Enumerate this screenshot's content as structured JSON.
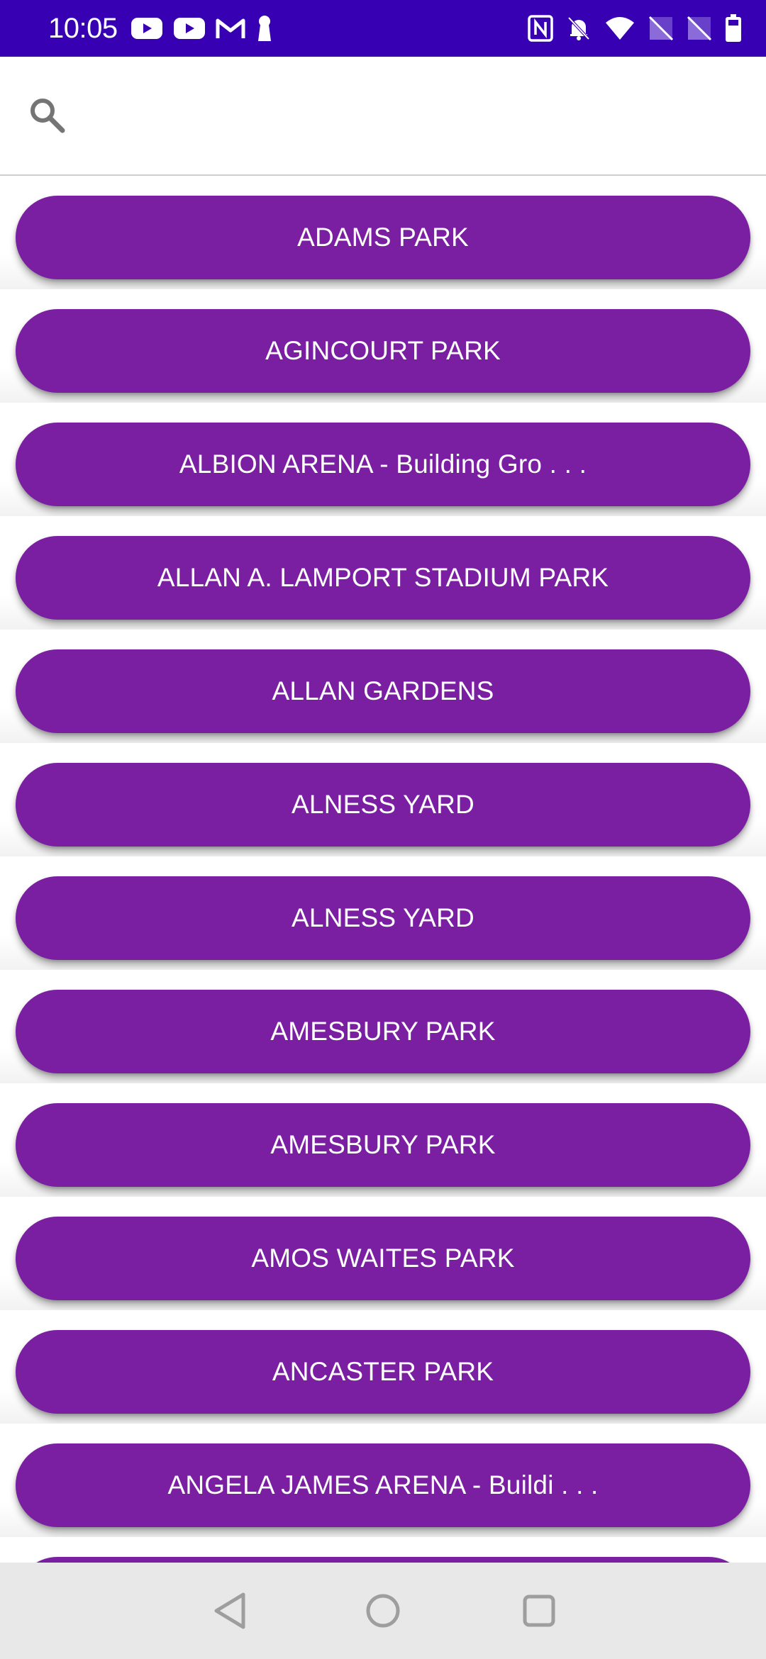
{
  "status_bar": {
    "time": "10:05",
    "left_icons": [
      "youtube-icon",
      "youtube-icon",
      "gmail-icon",
      "keyhole-icon"
    ],
    "right_icons": [
      "nfc-icon",
      "notifications-off-icon",
      "wifi-icon",
      "no-sim-icon",
      "no-sim-icon",
      "battery-icon"
    ],
    "background": "#3700b3"
  },
  "search": {
    "icon": "search-icon",
    "value": "",
    "placeholder": ""
  },
  "list": {
    "button_color": "#7b1fa2",
    "items": [
      {
        "label": "ADAMS PARK"
      },
      {
        "label": "AGINCOURT PARK"
      },
      {
        "label": "ALBION ARENA - Building Gro . . ."
      },
      {
        "label": "ALLAN A. LAMPORT STADIUM PARK"
      },
      {
        "label": "ALLAN GARDENS"
      },
      {
        "label": "ALNESS YARD"
      },
      {
        "label": "ALNESS YARD"
      },
      {
        "label": "AMESBURY PARK"
      },
      {
        "label": "AMESBURY PARK"
      },
      {
        "label": "AMOS WAITES PARK"
      },
      {
        "label": "ANCASTER PARK"
      },
      {
        "label": "ANGELA JAMES ARENA - Buildi . . ."
      },
      {
        "label": ""
      }
    ]
  },
  "nav_bar": {
    "buttons": [
      "back-icon",
      "home-icon",
      "recents-icon"
    ]
  }
}
